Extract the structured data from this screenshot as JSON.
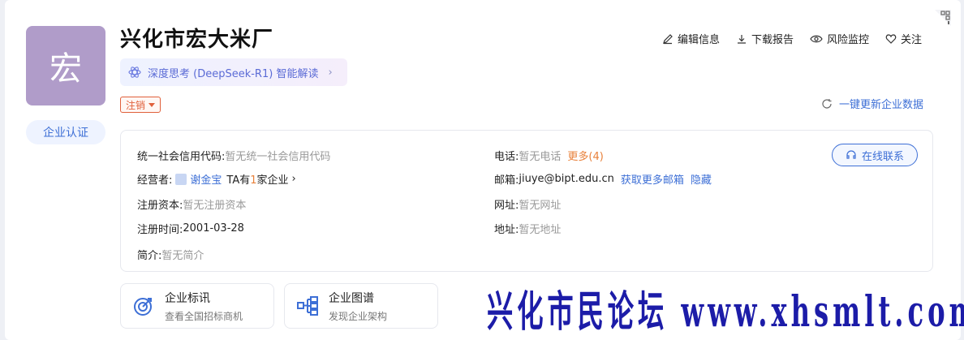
{
  "company": {
    "logo_char": "宏",
    "name": "兴化市宏大米厂",
    "ai_chip": "深度思考 (DeepSeek-R1) 智能解读",
    "status": "注销",
    "cert_label": "企业认证"
  },
  "actions": {
    "edit": "编辑信息",
    "download": "下载报告",
    "monitor": "风险监控",
    "follow": "关注"
  },
  "refresh_label": "一键更新企业数据",
  "info": {
    "credit_code_label": "统一社会信用代码:",
    "credit_code_value": "暂无统一社会信用代码",
    "operator_label": "经营者:",
    "operator_name": "谢金宝",
    "operator_extra_prefix": "TA有",
    "operator_extra_count": "1",
    "operator_extra_suffix": "家企业",
    "capital_label": "注册资本:",
    "capital_value": "暂无注册资本",
    "reg_time_label": "注册时间:",
    "reg_time_value": "2001-03-28",
    "intro_label": "简介:",
    "intro_value": "暂无简介",
    "phone_label": "电话:",
    "phone_value": "暂无电话",
    "phone_more": "更多(4)",
    "email_label": "邮箱:",
    "email_value": "jiuye@bipt.edu.cn",
    "email_more": "获取更多邮箱",
    "email_hide": "隐藏",
    "website_label": "网址:",
    "website_value": "暂无网址",
    "address_label": "地址:",
    "address_value": "暂无地址",
    "chat_button": "在线联系"
  },
  "cards": [
    {
      "title": "企业标讯",
      "subtitle": "查看全国招标商机"
    },
    {
      "title": "企业图谱",
      "subtitle": "发现企业架构"
    }
  ],
  "watermark": "兴化市民论坛 www.xhsmlt.com",
  "colors": {
    "accent": "#3d6fd6",
    "status": "#e0603b",
    "logo_bg": "#b09cc9",
    "more": "#e8803a"
  }
}
